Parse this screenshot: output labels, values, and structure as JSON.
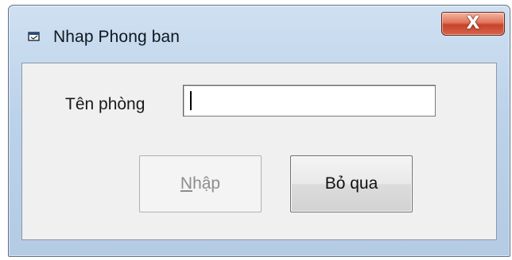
{
  "window": {
    "title": "Nhap Phong ban",
    "icon": "form-icon",
    "close_glyph": "X"
  },
  "form": {
    "department_label": "Tên phòng",
    "department_value": "",
    "department_placeholder": ""
  },
  "buttons": {
    "submit": {
      "accel": "N",
      "rest": "hập",
      "enabled": false
    },
    "cancel": {
      "label": "Bỏ qua",
      "enabled": true
    }
  },
  "colors": {
    "titlebar": "#bcd2ea",
    "close_button": "#c7432a",
    "client_bg": "#f0f0f0",
    "disabled_text": "#8d8d8d"
  }
}
